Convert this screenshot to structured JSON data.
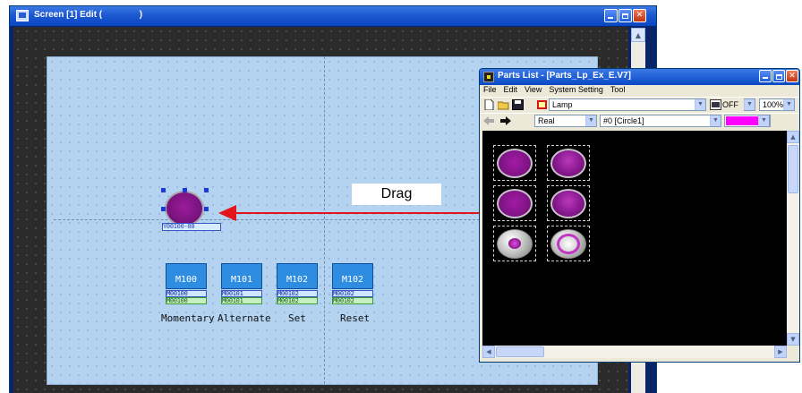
{
  "screen_window": {
    "title": "Screen [1] Edit (               )",
    "switches": [
      {
        "face": "M100",
        "tag1": "M00100",
        "tag2": "M00100",
        "label": "Momentary"
      },
      {
        "face": "M101",
        "tag1": "M00101",
        "tag2": "M00101",
        "label": "Alternate"
      },
      {
        "face": "M102",
        "tag1": "M00102",
        "tag2": "M00102",
        "label": "Set"
      },
      {
        "face": "M102",
        "tag1": "M00102",
        "tag2": "M00102",
        "label": "Reset"
      }
    ],
    "placed_lamp_tag": "Y00100-00"
  },
  "annotation": {
    "drag_label": "Drag",
    "arrow_color": "#e3141b"
  },
  "parts_window": {
    "title": "Parts List - [Parts_Lp_Ex_E.V7]",
    "menu": [
      "File",
      "Edit",
      "View",
      "System Setting",
      "Tool"
    ],
    "category_select": "Lamp",
    "state_icon_label": "OFF",
    "state_select": "OFF",
    "zoom_select": "100%",
    "real_select": "Real",
    "part_select": "#0 [Circle1]",
    "color_swatch": "#ff00ff"
  },
  "colors": {
    "titlebar": "#0a47c4",
    "design_area": "#b4d3f0",
    "lamp_purple": "#74127a",
    "switch_blue": "#2e8de0"
  }
}
